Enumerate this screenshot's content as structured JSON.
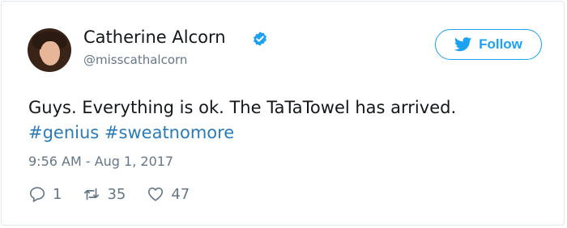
{
  "user": {
    "name": "Catherine Alcorn",
    "handle": "@misscathalcorn",
    "verified": true
  },
  "follow_button": {
    "label": "Follow",
    "icon": "twitter-bird-icon",
    "color": "#1da1f2"
  },
  "tweet": {
    "text": "Guys. Everything is ok. The TaTaTowel has arrived.",
    "hashtags": [
      "#genius",
      "#sweatnomore"
    ],
    "timestamp": "9:56 AM - Aug 1, 2017"
  },
  "actions": {
    "replies": "1",
    "retweets": "35",
    "likes": "47"
  },
  "colors": {
    "link": "#2b7bb9",
    "muted": "#657786",
    "text": "#14171a",
    "verified": "#1da1f2"
  }
}
